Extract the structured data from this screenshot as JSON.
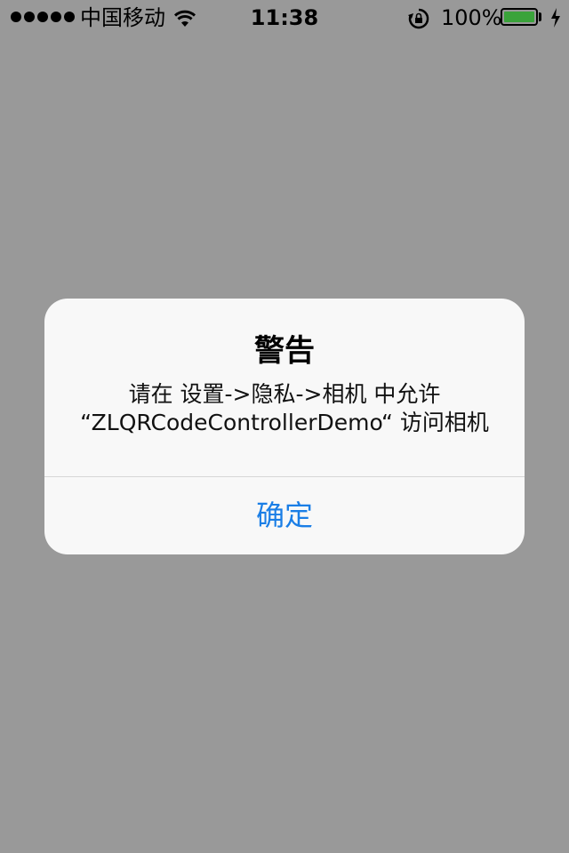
{
  "status_bar": {
    "carrier": "中国移动",
    "time": "11:38",
    "battery_percent": "100%",
    "battery_level": 1.0,
    "battery_color": "#3aa33a",
    "icons": [
      "signal-dots-icon",
      "wifi-icon",
      "rotation-lock-icon",
      "battery-icon",
      "charging-icon"
    ]
  },
  "alert": {
    "title": "警告",
    "message_line1": "请在 设置->隐私->相机 中允许",
    "message_line2": "“ZLQRCodeControllerDemo“ 访问相机",
    "button_label": "确定",
    "button_color": "#1a7ee6"
  },
  "colors": {
    "background": "#999999",
    "alert_background": "#f8f8f8"
  }
}
